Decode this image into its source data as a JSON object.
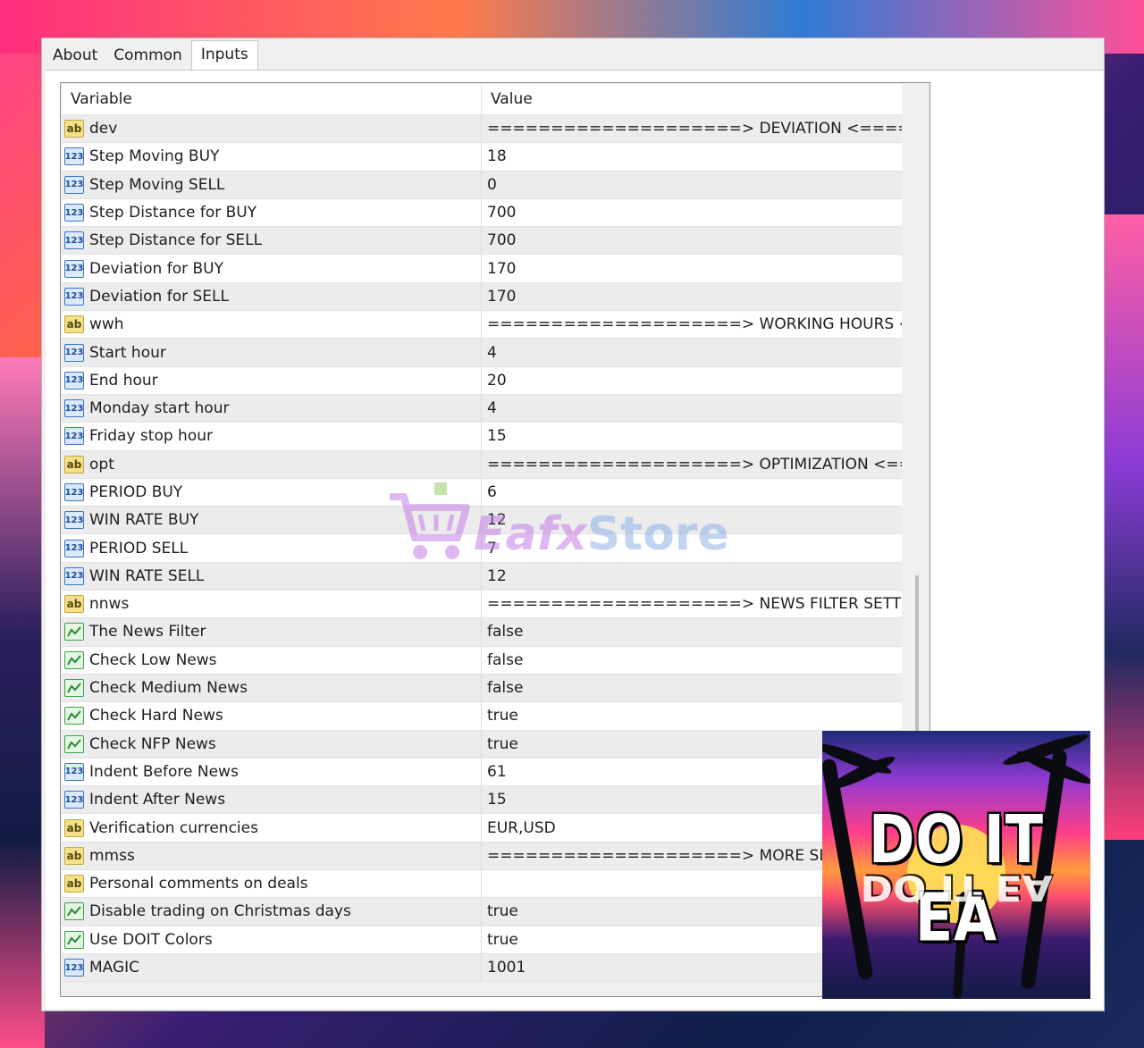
{
  "tabs": [
    {
      "label": "About",
      "active": false
    },
    {
      "label": "Common",
      "active": false
    },
    {
      "label": "Inputs",
      "active": true
    }
  ],
  "table": {
    "columns": [
      "Variable",
      "Value"
    ],
    "rows": [
      {
        "type": "string",
        "icon": "ab-string-icon",
        "name": "dev",
        "value": "====================> DEVIATION <===============..."
      },
      {
        "type": "int",
        "icon": "123-integer-icon",
        "name": "Step Moving BUY",
        "value": "18"
      },
      {
        "type": "int",
        "icon": "123-integer-icon",
        "name": "Step Moving SELL",
        "value": "0"
      },
      {
        "type": "int",
        "icon": "123-integer-icon",
        "name": "Step Distance for BUY",
        "value": "700"
      },
      {
        "type": "int",
        "icon": "123-integer-icon",
        "name": "Step Distance for SELL",
        "value": "700"
      },
      {
        "type": "int",
        "icon": "123-integer-icon",
        "name": "Deviation for BUY",
        "value": "170"
      },
      {
        "type": "int",
        "icon": "123-integer-icon",
        "name": "Deviation for SELL",
        "value": "170"
      },
      {
        "type": "string",
        "icon": "ab-string-icon",
        "name": "wwh",
        "value": "====================> WORKING HOURS <=========..."
      },
      {
        "type": "int",
        "icon": "123-integer-icon",
        "name": "Start hour",
        "value": "4"
      },
      {
        "type": "int",
        "icon": "123-integer-icon",
        "name": "End hour",
        "value": "20"
      },
      {
        "type": "int",
        "icon": "123-integer-icon",
        "name": "Monday start hour",
        "value": "4"
      },
      {
        "type": "int",
        "icon": "123-integer-icon",
        "name": "Friday stop hour",
        "value": "15"
      },
      {
        "type": "string",
        "icon": "ab-string-icon",
        "name": "opt",
        "value": "====================> OPTIMIZATION <============..."
      },
      {
        "type": "int",
        "icon": "123-integer-icon",
        "name": "PERIOD BUY",
        "value": "6"
      },
      {
        "type": "int",
        "icon": "123-integer-icon",
        "name": "WIN RATE BUY",
        "value": "12"
      },
      {
        "type": "int",
        "icon": "123-integer-icon",
        "name": "PERIOD SELL",
        "value": "7"
      },
      {
        "type": "int",
        "icon": "123-integer-icon",
        "name": "WIN RATE SELL",
        "value": "12"
      },
      {
        "type": "string",
        "icon": "ab-string-icon",
        "name": "nnws",
        "value": "====================> NEWS FILTER SETTINGS <===..."
      },
      {
        "type": "bool",
        "icon": "bool-chart-icon",
        "name": "The News Filter",
        "value": "false"
      },
      {
        "type": "bool",
        "icon": "bool-chart-icon",
        "name": "Check Low News",
        "value": "false"
      },
      {
        "type": "bool",
        "icon": "bool-chart-icon",
        "name": "Check Medium News",
        "value": "false"
      },
      {
        "type": "bool",
        "icon": "bool-chart-icon",
        "name": "Check Hard News",
        "value": "true"
      },
      {
        "type": "bool",
        "icon": "bool-chart-icon",
        "name": "Check NFP News",
        "value": "true"
      },
      {
        "type": "int",
        "icon": "123-integer-icon",
        "name": "Indent Before News",
        "value": "61"
      },
      {
        "type": "int",
        "icon": "123-integer-icon",
        "name": "Indent After News",
        "value": "15"
      },
      {
        "type": "string",
        "icon": "ab-string-icon",
        "name": "Verification currencies",
        "value": "EUR,USD"
      },
      {
        "type": "string",
        "icon": "ab-string-icon",
        "name": "mmss",
        "value": "====================> MORE SETTINGS <==="
      },
      {
        "type": "string",
        "icon": "ab-string-icon",
        "name": "Personal comments on deals",
        "value": ""
      },
      {
        "type": "bool",
        "icon": "bool-chart-icon",
        "name": "Disable trading on Christmas days",
        "value": "true"
      },
      {
        "type": "bool",
        "icon": "bool-chart-icon",
        "name": "Use DOIT Colors",
        "value": "true"
      },
      {
        "type": "int",
        "icon": "123-integer-icon",
        "name": "MAGIC",
        "value": "1001"
      }
    ]
  },
  "watermark": {
    "text_a": "Eafx",
    "text_b": "Store"
  },
  "cover": {
    "title": "DO IT EA"
  }
}
